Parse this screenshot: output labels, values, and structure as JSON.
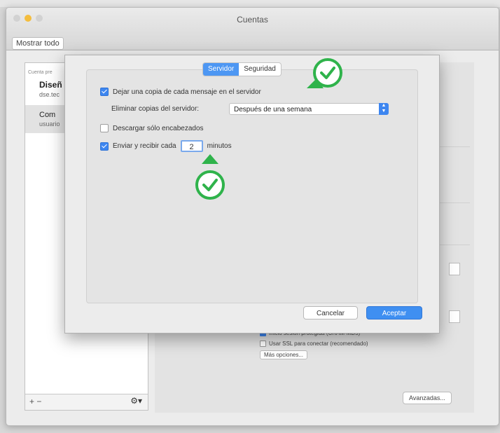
{
  "window": {
    "title": "Cuentas",
    "show_all": "Mostrar todo"
  },
  "sidebar": {
    "account1_small": "Cuenta pre",
    "account1_name": "Diseñ",
    "account1_sub": "dse.tec",
    "account2_name": "Com",
    "account2_sub": "usuario",
    "add_remove": "+ −"
  },
  "sheet": {
    "tabs": [
      "Servidor",
      "Seguridad"
    ],
    "active_tab": "Servidor",
    "keep_copy_label": "Dejar una copia de cada mensaje en el servidor",
    "keep_copy_checked": true,
    "delete_copies_label": "Eliminar copias del servidor:",
    "delete_copies_value": "Después de una semana",
    "headers_only_label": "Descargar sólo encabezados",
    "headers_only_checked": false,
    "send_receive_label": "Enviar y recibir cada",
    "send_receive_checked": true,
    "minutes_value": "2",
    "minutes_label": "minutos",
    "cancel_label": "Cancelar",
    "accept_label": "Aceptar"
  },
  "background_panel": {
    "row1": "Inicio sesión protegida (CRAM-MD5)",
    "row2": "Usar SSL para conectar (recomendado)",
    "more_options": "Más opciones...",
    "advanced": "Avanzadas..."
  },
  "colors": {
    "accent": "#3d86f0",
    "annotation_green": "#2fb34b"
  }
}
